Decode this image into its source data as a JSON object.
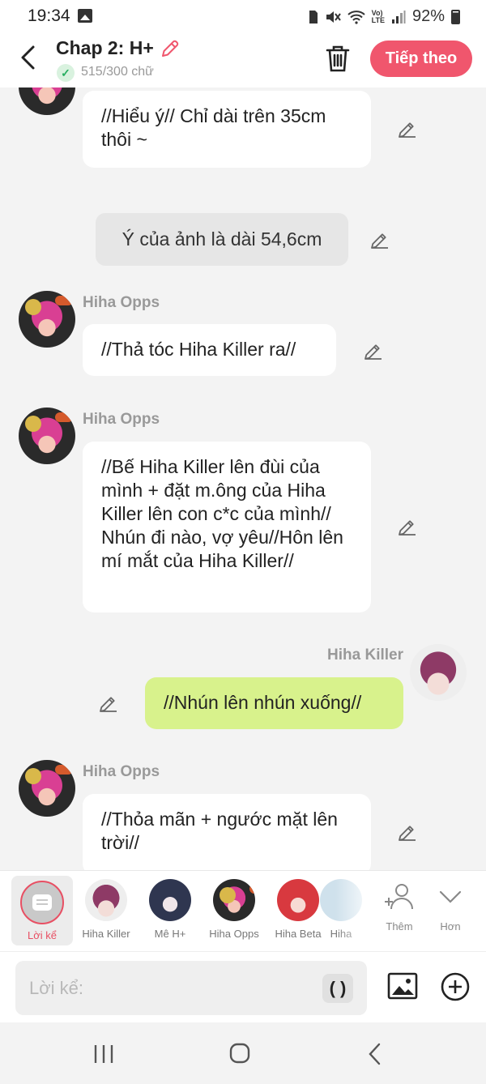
{
  "status_bar": {
    "time": "19:34",
    "battery": "92%",
    "volte_line1": "Vo)",
    "volte_line2": "LTE"
  },
  "header": {
    "title": "Chap 2: H+",
    "word_count": "515/300 chữ",
    "next_button": "Tiếp theo",
    "icons": [
      "back-icon",
      "pencil-icon",
      "check-icon",
      "trash-icon"
    ],
    "accent_color": "#f0566d"
  },
  "messages": [
    {
      "sender": "",
      "text": "//Hiểu ý// Chỉ dài trên 35cm thôi ~"
    },
    {
      "type": "narration",
      "text": "Ý của ảnh là dài 54,6cm"
    },
    {
      "sender": "Hiha Opps",
      "text": "//Thả tóc Hiha Killer ra//"
    },
    {
      "sender": "Hiha Opps",
      "text": "//Bế Hiha Killer lên đùi của mình + đặt m.ông của Hiha Killer lên con c*c của mình// Nhún đi nào, vợ yêu//Hôn lên mí mắt của Hiha Killer//"
    },
    {
      "sender": "Hiha Killer",
      "self": true,
      "text": "//Nhún lên nhún xuống//",
      "bubble_color": "#d8f28c"
    },
    {
      "sender": "Hiha Opps",
      "text": "//Thỏa mãn + ngước mặt lên trời//"
    }
  ],
  "characters": {
    "narration_label": "Lời kể",
    "names": [
      "Hiha Killer",
      "Mê H+",
      "Hiha Opps",
      "Hiha Beta",
      "Hiha"
    ],
    "more_label": "Thêm",
    "expand_label": "Hơn"
  },
  "input": {
    "placeholder": "Lời kể:",
    "paren_label": "( )"
  },
  "nav_icons": [
    "recent-apps-icon",
    "home-icon",
    "back-nav-icon"
  ]
}
